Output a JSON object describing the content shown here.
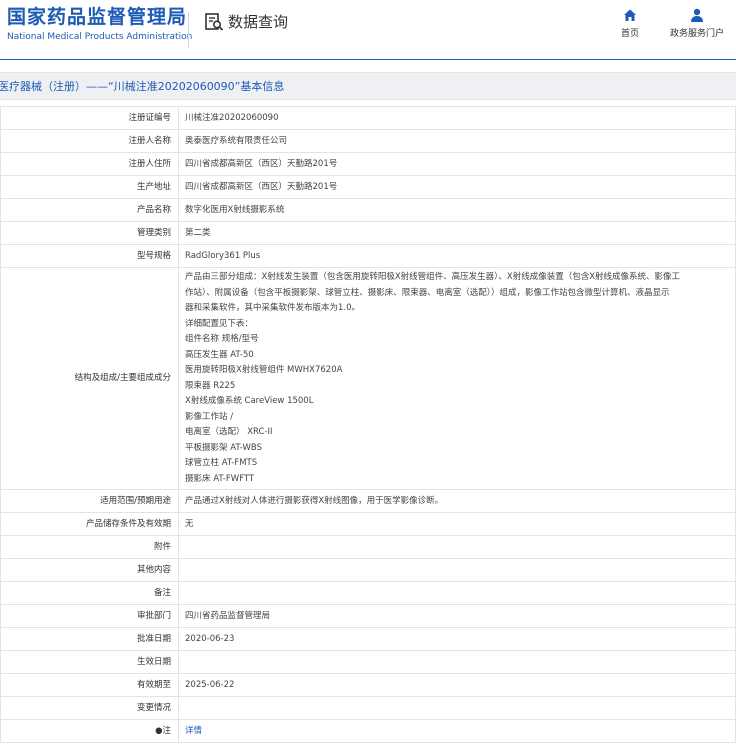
{
  "header": {
    "brand_cn": "国家药品监督管理局",
    "brand_en": "National Medical Products Administration",
    "query_label": "数据查询",
    "nav": [
      {
        "label": "首页",
        "icon": "home-icon"
      },
      {
        "label": "政务服务门户",
        "icon": "user-icon"
      }
    ]
  },
  "title": "医疗器械（注册）——“川械注准20202060090”基本信息",
  "rows": [
    {
      "label": "注册证编号",
      "value": "川械注准20202060090"
    },
    {
      "label": "注册人名称",
      "value": "奥泰医疗系统有限责任公司"
    },
    {
      "label": "注册人住所",
      "value": "四川省成都高新区（西区）天勤路201号"
    },
    {
      "label": "生产地址",
      "value": "四川省成都高新区（西区）天勤路201号"
    },
    {
      "label": "产品名称",
      "value": "数字化医用X射线摄影系统"
    },
    {
      "label": "管理类别",
      "value": "第二类"
    },
    {
      "label": "型号规格",
      "value": "RadGlory361 Plus"
    }
  ],
  "structure": {
    "label": "结构及组成/主要组成成分",
    "lines": [
      "产品由三部分组成：X射线发生装置（包含医用旋转阳极X射线管组件、高压发生器）、X射线成像装置（包含X射线成像系统、影像工",
      "作站）、附属设备（包含平板摄影架、球管立柱、摄影床、限束器、电离室（选配））组成，影像工作站包含微型计算机、液晶显示",
      "器和采集软件，其中采集软件发布版本为1.0。",
      "详细配置见下表：",
      "组件名称 规格/型号",
      "高压发生器 AT-50",
      "医用旋转阳极X射线管组件 MWHX7620A",
      "限束器 R225",
      "X射线成像系统 CareView 1500L",
      "影像工作站 /",
      "电离室（选配） XRC-II",
      "平板摄影架 AT-WBS",
      "球管立柱 AT-FMTS",
      "摄影床 AT-FWFTT"
    ]
  },
  "rows2": [
    {
      "label": "适用范围/预期用途",
      "value": "产品通过X射线对人体进行摄影获得X射线图像，用于医学影像诊断。"
    },
    {
      "label": "产品储存条件及有效期",
      "value": "无"
    },
    {
      "label": "附件",
      "value": ""
    },
    {
      "label": "其他内容",
      "value": ""
    },
    {
      "label": "备注",
      "value": ""
    },
    {
      "label": "审批部门",
      "value": "四川省药品监督管理局"
    },
    {
      "label": "批准日期",
      "value": "2020-06-23"
    },
    {
      "label": "生效日期",
      "value": ""
    },
    {
      "label": "有效期至",
      "value": "2025-06-22"
    },
    {
      "label": "变更情况",
      "value": ""
    }
  ],
  "note": {
    "label": "●注",
    "value": "详情"
  }
}
